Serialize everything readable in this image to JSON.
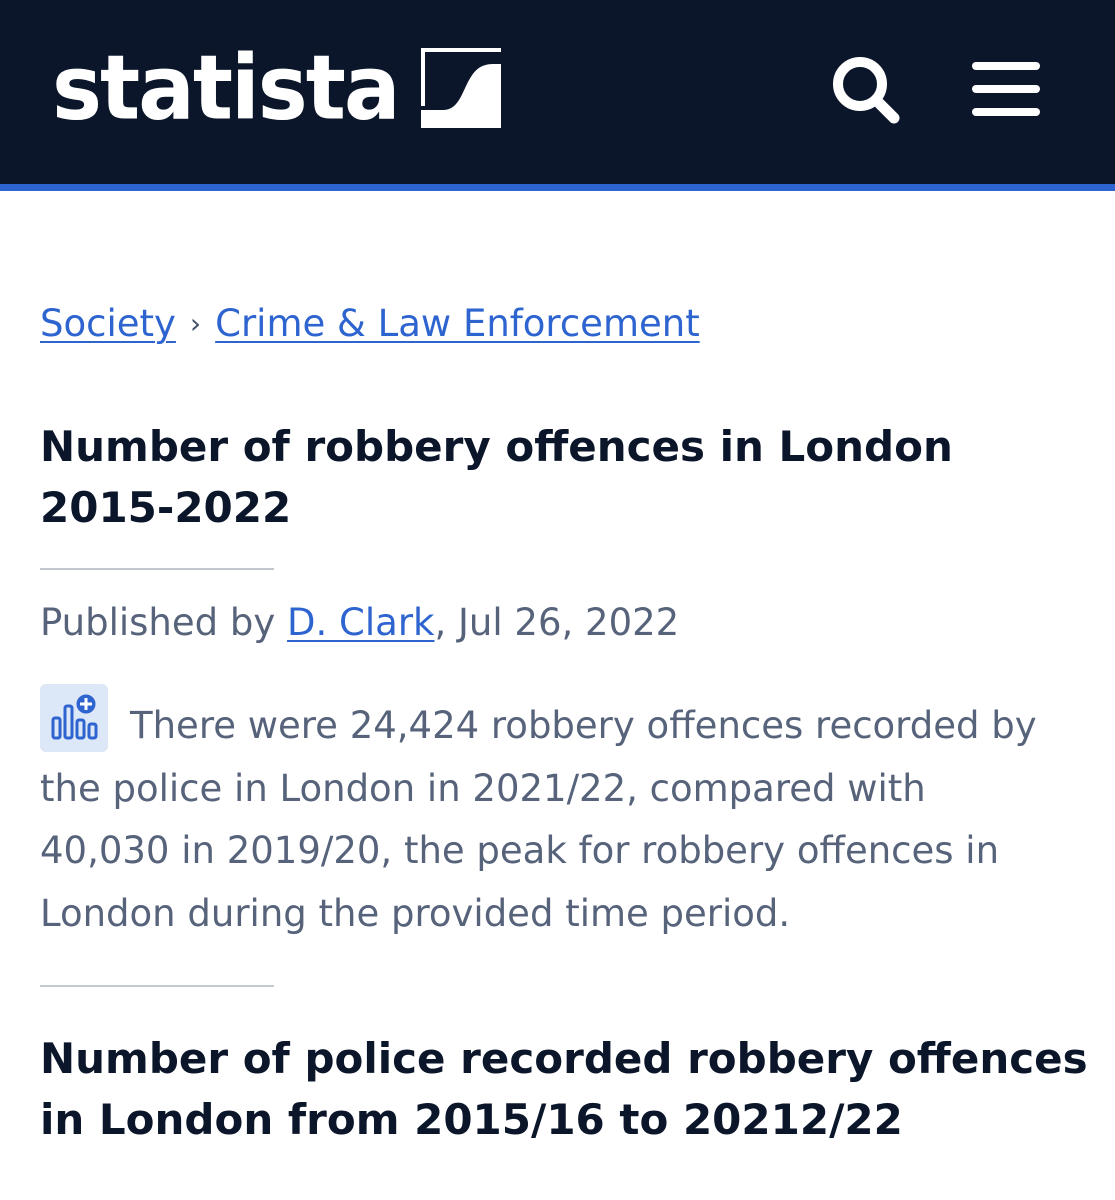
{
  "header": {
    "logo_text": "statista",
    "background_color": "#0b162a",
    "accent_color": "#2e64cf",
    "icons": [
      "statista-logo-mark-icon",
      "search-icon",
      "menu-icon"
    ]
  },
  "breadcrumb": {
    "items": [
      {
        "label": "Society"
      },
      {
        "label": "Crime & Law Enforcement"
      }
    ],
    "separator": "›"
  },
  "article": {
    "title": "Number of robbery offences in London 2015-2022",
    "published_prefix": "Published by ",
    "author": "D. Clark",
    "published_suffix": ", Jul 26, 2022",
    "description": "There were 24,424 robbery offences recorded by the police in London in 2021/22, compared with 40,030 in 2019/20, the peak for robbery offences in London during the provided time period.",
    "description_icon": "add-statistic-icon"
  },
  "chart_section": {
    "title": "Number of police recorded robbery offences in London from 2015/16 to 20212/22"
  },
  "colors": {
    "link": "#2e64cf",
    "heading": "#0b162a",
    "body_text": "#56637a"
  }
}
